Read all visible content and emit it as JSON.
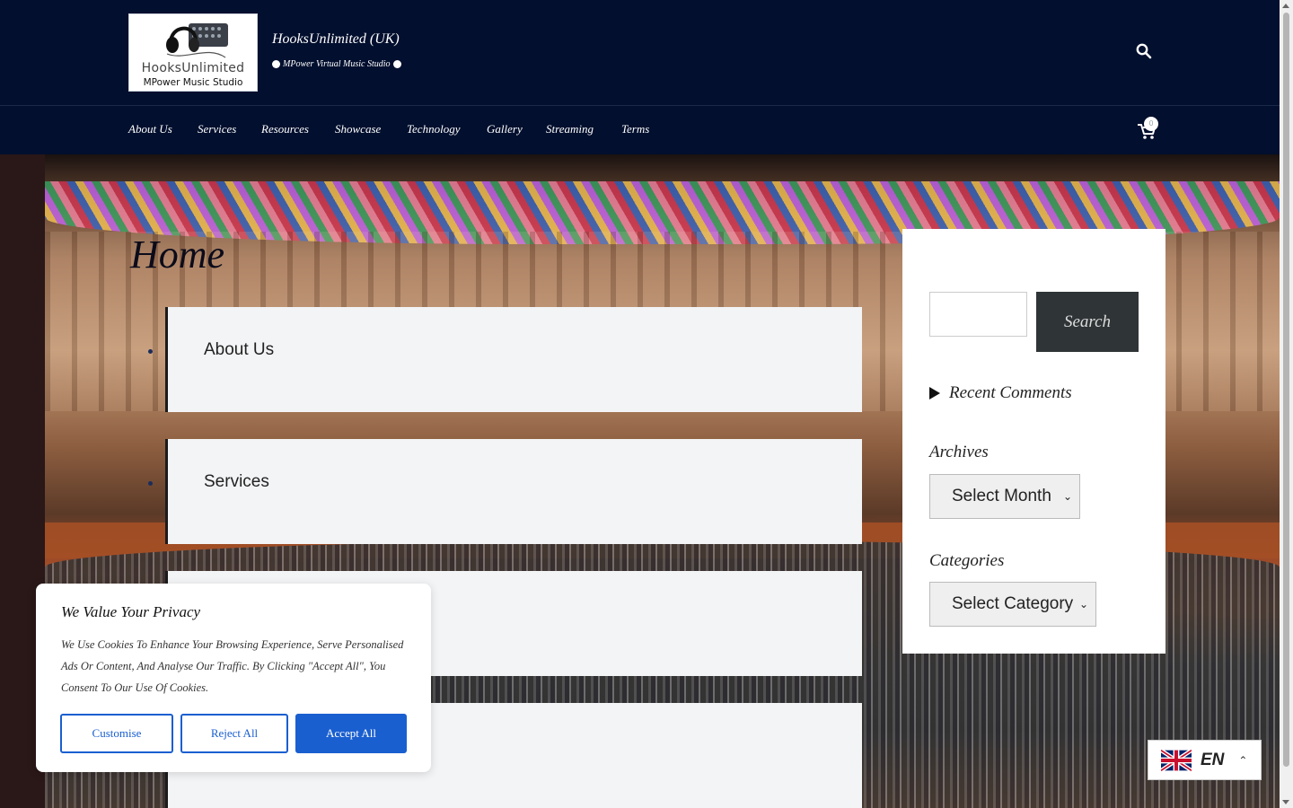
{
  "header": {
    "logo": {
      "line1": "HooksUnlimited",
      "line2": "MPower Music Studio"
    },
    "site_title": "HooksUnlimited (UK)",
    "tagline": "MPower Virtual Music Studio",
    "search_icon": "search-icon"
  },
  "nav": {
    "items": [
      "About Us",
      "Services",
      "Resources",
      "Showcase",
      "Technology",
      "Gallery",
      "Streaming",
      "Terms"
    ],
    "cart_count": "0",
    "cart_icon": "cart-icon"
  },
  "main": {
    "page_title": "Home",
    "cards": [
      {
        "label": "About Us"
      },
      {
        "label": "Services"
      },
      {
        "label": ""
      },
      {
        "label": ""
      }
    ]
  },
  "sidebar": {
    "search_placeholder": "",
    "search_button": "Search",
    "recent_comments": "Recent Comments",
    "archives_heading": "Archives",
    "archives_select": "Select Month",
    "categories_heading": "Categories",
    "categories_select": "Select Category"
  },
  "cookie": {
    "title": "We Value Your Privacy",
    "text": "We Use Cookies To Enhance Your Browsing Experience, Serve Personalised Ads Or Content, And Analyse Our Traffic. By Clicking \"Accept All\", You Consent To Our Use Of Cookies.",
    "customise": "Customise",
    "reject": "Reject All",
    "accept": "Accept All"
  },
  "language": {
    "code": "EN",
    "flag_icon": "uk-flag-icon"
  },
  "colors": {
    "header_bg": "#020f2e",
    "accent": "#1a5fd0",
    "search_button_bg": "#2f3436"
  }
}
